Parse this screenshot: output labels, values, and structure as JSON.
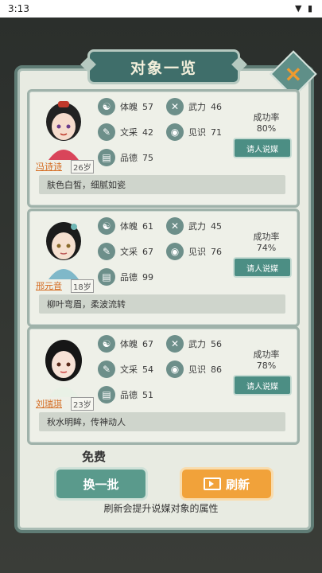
{
  "statusbar": {
    "time": "3:13",
    "icons": "wifi-icon battery-icon"
  },
  "title": "对象一览",
  "close_icon": "×",
  "labels": {
    "tipo": "体魄",
    "wuli": "武力",
    "wencai": "文采",
    "jianshi": "见识",
    "pinde": "品德",
    "rate": "成功率"
  },
  "cards": [
    {
      "name": "冯诗诗",
      "age": "26岁",
      "tipo": "57",
      "wuli": "46",
      "wencai": "42",
      "jianshi": "71",
      "pinde": "75",
      "rate": "80%",
      "button": "请人说媒",
      "desc": "肤色白皙，细腻如瓷"
    },
    {
      "name": "邢元音",
      "age": "18岁",
      "tipo": "61",
      "wuli": "45",
      "wencai": "67",
      "jianshi": "76",
      "pinde": "99",
      "rate": "74%",
      "button": "请人说媒",
      "desc": "柳叶弯眉，柔波流转"
    },
    {
      "name": "刘瑞琪",
      "age": "23岁",
      "tipo": "67",
      "wuli": "56",
      "wencai": "54",
      "jianshi": "86",
      "pinde": "51",
      "rate": "78%",
      "button": "请人说媒",
      "desc": "秋水明眸，传神动人"
    }
  ],
  "free_label": "免费",
  "swap_button": "换一批",
  "refresh_button": "刷新",
  "hint": "刷新会提升说媒对象的属性",
  "colors": {
    "accent": "#4c8e84",
    "orange": "#f1a23a",
    "panel": "#e8ebe2"
  }
}
